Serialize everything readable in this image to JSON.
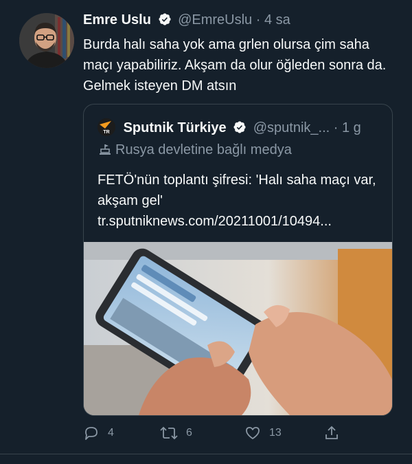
{
  "tweet": {
    "author_name": "Emre Uslu",
    "author_handle": "@EmreUslu",
    "separator": "·",
    "time": "4 sa",
    "text": "Burda halı saha yok ama grlen olursa çim saha maçı yapabiliriz. Akşam da olur öğleden sonra da. Gelmek isteyen DM atsın"
  },
  "quote": {
    "author_name": "Sputnik Türkiye",
    "author_handle": "@sputnik_...",
    "separator": "·",
    "time": "1 g",
    "logo_text": "TR",
    "label": "Rusya devletine bağlı medya",
    "text_line1": "FETÖ'nün toplantı şifresi: 'Halı saha maçı var, akşam gel'",
    "link": "tr.sputniknews.com/20211001/10494..."
  },
  "actions": {
    "reply_count": "4",
    "retweet_count": "6",
    "like_count": "13"
  },
  "colors": {
    "background": "#15202b",
    "verified": "#1d9bf0",
    "muted": "#8b98a5",
    "border": "#38444d"
  }
}
